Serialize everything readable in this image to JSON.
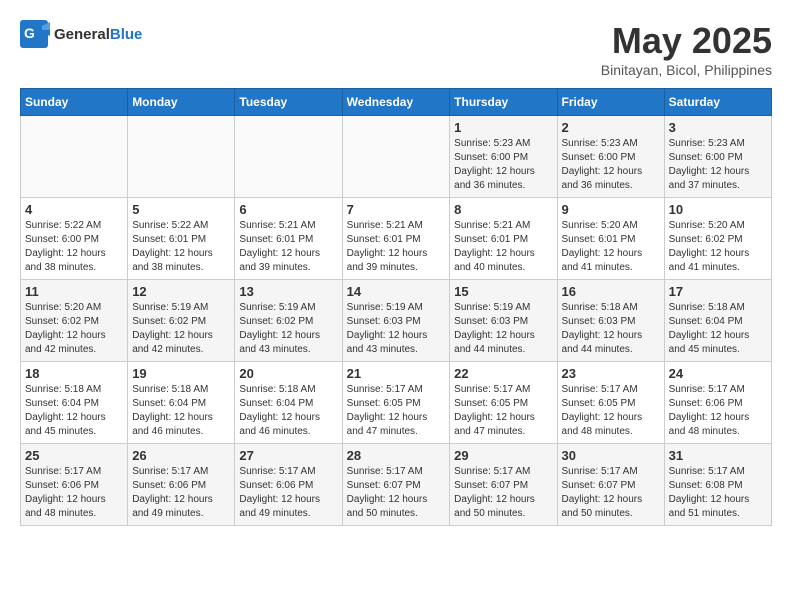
{
  "header": {
    "logo_general": "General",
    "logo_blue": "Blue",
    "month": "May 2025",
    "location": "Binitayan, Bicol, Philippines"
  },
  "days_of_week": [
    "Sunday",
    "Monday",
    "Tuesday",
    "Wednesday",
    "Thursday",
    "Friday",
    "Saturday"
  ],
  "weeks": [
    [
      {
        "num": "",
        "info": ""
      },
      {
        "num": "",
        "info": ""
      },
      {
        "num": "",
        "info": ""
      },
      {
        "num": "",
        "info": ""
      },
      {
        "num": "1",
        "info": "Sunrise: 5:23 AM\nSunset: 6:00 PM\nDaylight: 12 hours\nand 36 minutes."
      },
      {
        "num": "2",
        "info": "Sunrise: 5:23 AM\nSunset: 6:00 PM\nDaylight: 12 hours\nand 36 minutes."
      },
      {
        "num": "3",
        "info": "Sunrise: 5:23 AM\nSunset: 6:00 PM\nDaylight: 12 hours\nand 37 minutes."
      }
    ],
    [
      {
        "num": "4",
        "info": "Sunrise: 5:22 AM\nSunset: 6:00 PM\nDaylight: 12 hours\nand 38 minutes."
      },
      {
        "num": "5",
        "info": "Sunrise: 5:22 AM\nSunset: 6:01 PM\nDaylight: 12 hours\nand 38 minutes."
      },
      {
        "num": "6",
        "info": "Sunrise: 5:21 AM\nSunset: 6:01 PM\nDaylight: 12 hours\nand 39 minutes."
      },
      {
        "num": "7",
        "info": "Sunrise: 5:21 AM\nSunset: 6:01 PM\nDaylight: 12 hours\nand 39 minutes."
      },
      {
        "num": "8",
        "info": "Sunrise: 5:21 AM\nSunset: 6:01 PM\nDaylight: 12 hours\nand 40 minutes."
      },
      {
        "num": "9",
        "info": "Sunrise: 5:20 AM\nSunset: 6:01 PM\nDaylight: 12 hours\nand 41 minutes."
      },
      {
        "num": "10",
        "info": "Sunrise: 5:20 AM\nSunset: 6:02 PM\nDaylight: 12 hours\nand 41 minutes."
      }
    ],
    [
      {
        "num": "11",
        "info": "Sunrise: 5:20 AM\nSunset: 6:02 PM\nDaylight: 12 hours\nand 42 minutes."
      },
      {
        "num": "12",
        "info": "Sunrise: 5:19 AM\nSunset: 6:02 PM\nDaylight: 12 hours\nand 42 minutes."
      },
      {
        "num": "13",
        "info": "Sunrise: 5:19 AM\nSunset: 6:02 PM\nDaylight: 12 hours\nand 43 minutes."
      },
      {
        "num": "14",
        "info": "Sunrise: 5:19 AM\nSunset: 6:03 PM\nDaylight: 12 hours\nand 43 minutes."
      },
      {
        "num": "15",
        "info": "Sunrise: 5:19 AM\nSunset: 6:03 PM\nDaylight: 12 hours\nand 44 minutes."
      },
      {
        "num": "16",
        "info": "Sunrise: 5:18 AM\nSunset: 6:03 PM\nDaylight: 12 hours\nand 44 minutes."
      },
      {
        "num": "17",
        "info": "Sunrise: 5:18 AM\nSunset: 6:04 PM\nDaylight: 12 hours\nand 45 minutes."
      }
    ],
    [
      {
        "num": "18",
        "info": "Sunrise: 5:18 AM\nSunset: 6:04 PM\nDaylight: 12 hours\nand 45 minutes."
      },
      {
        "num": "19",
        "info": "Sunrise: 5:18 AM\nSunset: 6:04 PM\nDaylight: 12 hours\nand 46 minutes."
      },
      {
        "num": "20",
        "info": "Sunrise: 5:18 AM\nSunset: 6:04 PM\nDaylight: 12 hours\nand 46 minutes."
      },
      {
        "num": "21",
        "info": "Sunrise: 5:17 AM\nSunset: 6:05 PM\nDaylight: 12 hours\nand 47 minutes."
      },
      {
        "num": "22",
        "info": "Sunrise: 5:17 AM\nSunset: 6:05 PM\nDaylight: 12 hours\nand 47 minutes."
      },
      {
        "num": "23",
        "info": "Sunrise: 5:17 AM\nSunset: 6:05 PM\nDaylight: 12 hours\nand 48 minutes."
      },
      {
        "num": "24",
        "info": "Sunrise: 5:17 AM\nSunset: 6:06 PM\nDaylight: 12 hours\nand 48 minutes."
      }
    ],
    [
      {
        "num": "25",
        "info": "Sunrise: 5:17 AM\nSunset: 6:06 PM\nDaylight: 12 hours\nand 48 minutes."
      },
      {
        "num": "26",
        "info": "Sunrise: 5:17 AM\nSunset: 6:06 PM\nDaylight: 12 hours\nand 49 minutes."
      },
      {
        "num": "27",
        "info": "Sunrise: 5:17 AM\nSunset: 6:06 PM\nDaylight: 12 hours\nand 49 minutes."
      },
      {
        "num": "28",
        "info": "Sunrise: 5:17 AM\nSunset: 6:07 PM\nDaylight: 12 hours\nand 50 minutes."
      },
      {
        "num": "29",
        "info": "Sunrise: 5:17 AM\nSunset: 6:07 PM\nDaylight: 12 hours\nand 50 minutes."
      },
      {
        "num": "30",
        "info": "Sunrise: 5:17 AM\nSunset: 6:07 PM\nDaylight: 12 hours\nand 50 minutes."
      },
      {
        "num": "31",
        "info": "Sunrise: 5:17 AM\nSunset: 6:08 PM\nDaylight: 12 hours\nand 51 minutes."
      }
    ]
  ]
}
